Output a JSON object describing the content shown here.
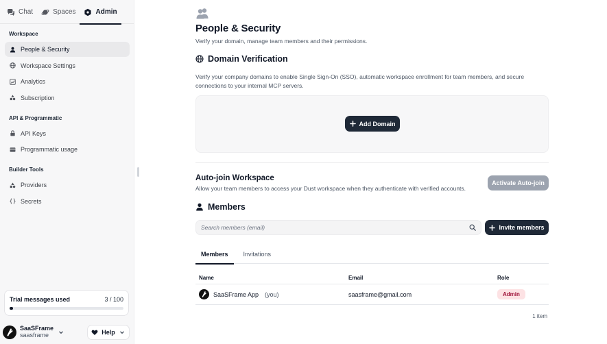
{
  "topnav": {
    "chat": "Chat",
    "spaces": "Spaces",
    "admin": "Admin"
  },
  "sidebar": {
    "sections": [
      {
        "title": "Workspace",
        "items": [
          {
            "label": "People & Security",
            "icon": "person-icon",
            "active": true
          },
          {
            "label": "Workspace Settings",
            "icon": "globe-icon"
          },
          {
            "label": "Analytics",
            "icon": "chart-icon"
          },
          {
            "label": "Subscription",
            "icon": "shapes-icon"
          }
        ]
      },
      {
        "title": "API & Programmatic",
        "items": [
          {
            "label": "API Keys",
            "icon": "lock-icon"
          },
          {
            "label": "Programmatic usage",
            "icon": "card-icon"
          }
        ]
      },
      {
        "title": "Builder Tools",
        "items": [
          {
            "label": "Providers",
            "icon": "shapes-icon"
          },
          {
            "label": "Secrets",
            "icon": "braces-icon"
          }
        ]
      }
    ]
  },
  "trial": {
    "label": "Trial messages used",
    "used": 3,
    "total": 100,
    "display": "3 / 100"
  },
  "user": {
    "name": "SaaSFrame",
    "workspace": "saasframe"
  },
  "help": {
    "label": "Help"
  },
  "page": {
    "title": "People & Security",
    "subtitle": "Verify your domain, manage team members and their permissions."
  },
  "domain": {
    "title": "Domain Verification",
    "description": "Verify your company domains to enable Single Sign-On (SSO), automatic workspace enrollment for team members, and secure connections to your internal MCP servers.",
    "add_button": "Add Domain"
  },
  "autojoin": {
    "title": "Auto-join Workspace",
    "description": "Allow your team members to access your Dust workspace when they authenticate with verified accounts.",
    "button": "Activate Auto-join"
  },
  "members": {
    "title": "Members",
    "search_placeholder": "Search members (email)",
    "invite_button": "Invite members",
    "tabs": [
      "Members",
      "Invitations"
    ],
    "columns": [
      "Name",
      "Email",
      "Role"
    ],
    "rows": [
      {
        "name": "SaaSFrame App",
        "you": "(you)",
        "email": "saasframe@gmail.com",
        "role": "Admin"
      }
    ],
    "count": "1 item"
  },
  "colors": {
    "primary": "#1f2937",
    "disabled": "#9ca3af",
    "admin_badge_bg": "#fde2e4",
    "admin_badge_text": "#9f1239"
  }
}
